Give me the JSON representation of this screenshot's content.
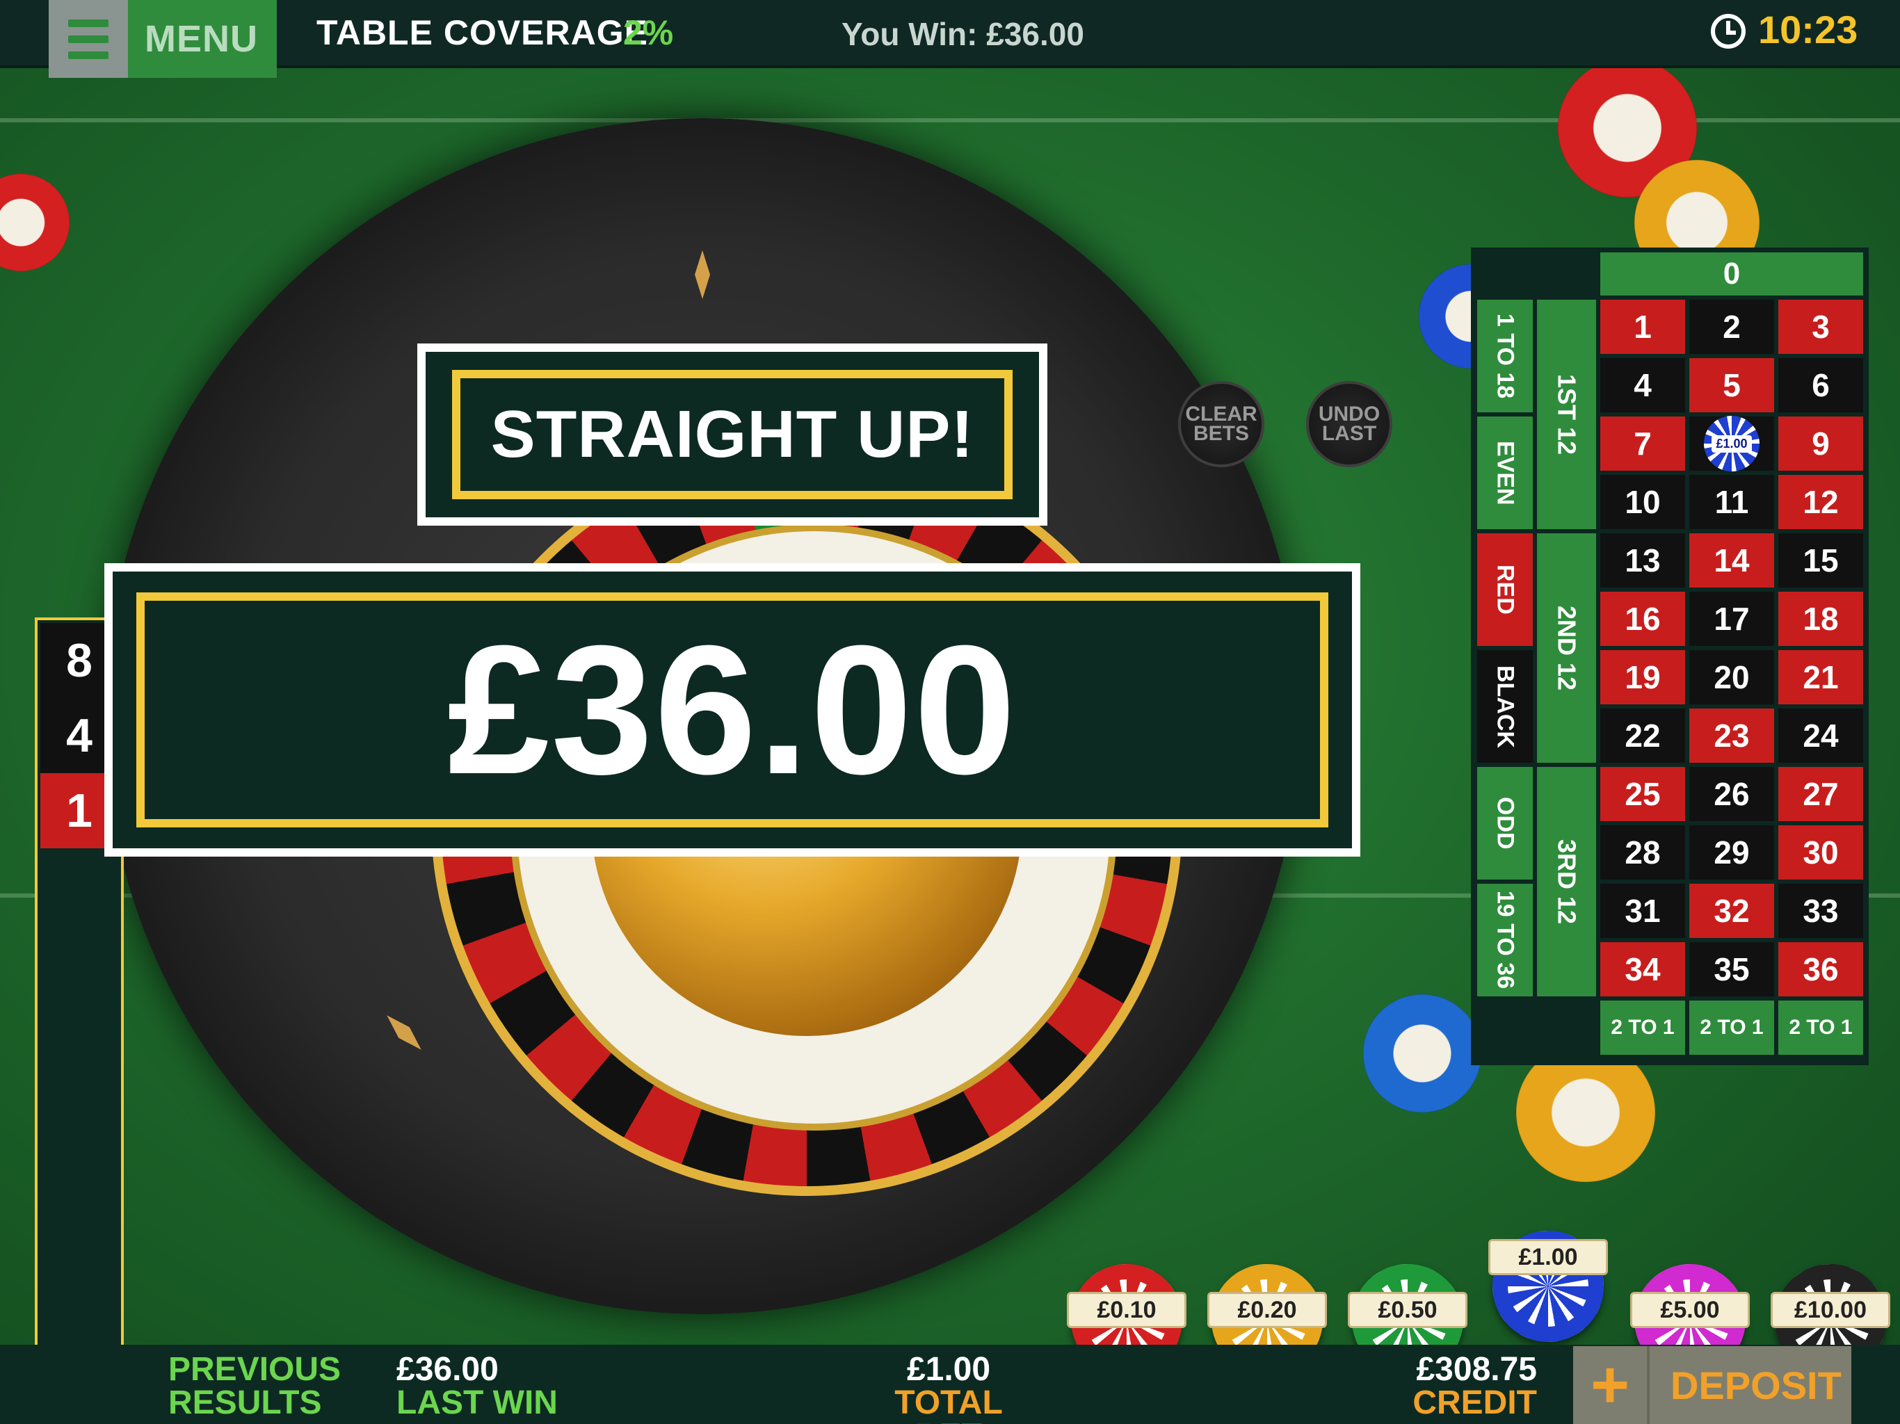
{
  "topbar": {
    "menu_label": "MENU",
    "table_coverage_label": "TABLE COVERAGE",
    "table_coverage_value": "2%",
    "you_win": "You Win: £36.00",
    "time": "10:23"
  },
  "wheel_buttons": {
    "clear_bets": "CLEAR BETS",
    "undo_last": "UNDO LAST"
  },
  "popup": {
    "title": "STRAIGHT UP!",
    "amount": "£36.00"
  },
  "history": [
    "8",
    "4",
    "1"
  ],
  "table": {
    "zero": "0",
    "numbers": [
      "1",
      "2",
      "3",
      "4",
      "5",
      "6",
      "7",
      "8",
      "9",
      "10",
      "11",
      "12",
      "13",
      "14",
      "15",
      "16",
      "17",
      "18",
      "19",
      "20",
      "21",
      "22",
      "23",
      "24",
      "25",
      "26",
      "27",
      "28",
      "29",
      "30",
      "31",
      "32",
      "33",
      "34",
      "35",
      "36"
    ],
    "dozens": [
      "1ST 12",
      "2ND 12",
      "3RD 12"
    ],
    "outside": [
      "1 TO 18",
      "EVEN",
      "RED",
      "BLACK",
      "ODD",
      "19 TO 36"
    ],
    "columns": [
      "2 TO 1",
      "2 TO 1",
      "2 TO 1"
    ],
    "placed_bet": {
      "number": "8",
      "label": "£1.00"
    }
  },
  "chips": [
    {
      "label": "£0.10",
      "color": "#d42020",
      "selected": false
    },
    {
      "label": "£0.20",
      "color": "#e6a51a",
      "selected": false
    },
    {
      "label": "£0.50",
      "color": "#1f9a3a",
      "selected": false
    },
    {
      "label": "£1.00",
      "color": "#1f3fd0",
      "selected": true
    },
    {
      "label": "£5.00",
      "color": "#d02ad0",
      "selected": false
    },
    {
      "label": "£10.00",
      "color": "#222222",
      "selected": false
    }
  ],
  "bottombar": {
    "previous_line1": "PREVIOUS",
    "previous_line2": "RESULTS",
    "last_win_value": "£36.00",
    "last_win_label": "LAST WIN",
    "total_bet_value": "£1.00",
    "total_bet_label": "TOTAL BET",
    "credit_value": "£308.75",
    "credit_label": "CREDIT",
    "deposit_label": "DEPOSIT"
  },
  "colors": {
    "accent_green": "#2f8c3c",
    "gold": "#f1c93a",
    "red": "#c81d1d",
    "dark_panel": "#0d2a22",
    "deposit_orange": "#f1a12a"
  }
}
